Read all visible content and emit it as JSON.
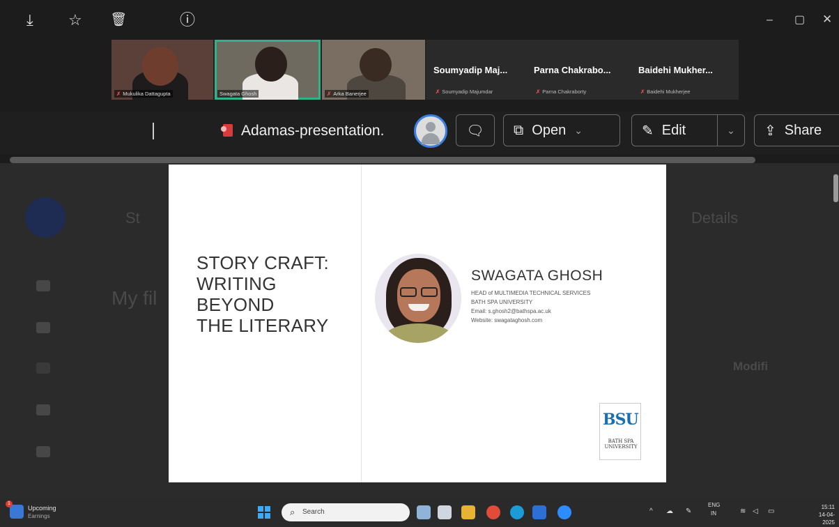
{
  "window": {
    "minimize_icon": "minimize-icon",
    "maximize_icon": "restore-icon",
    "close_icon": "close-icon",
    "minimize_glyph": "–",
    "maximize_glyph": "▢",
    "close_glyph": "✕"
  },
  "participants": [
    {
      "name": "Mukulika Dattagupta",
      "video": true,
      "active": false
    },
    {
      "name": "Swagata Ghosh",
      "video": true,
      "active": true
    },
    {
      "name": "Arka Banerjee",
      "video": true,
      "active": false
    },
    {
      "display": "Soumyadip Maj...",
      "name": "Soumyadip Majumdar",
      "video": false
    },
    {
      "display": "Parna Chakrabo...",
      "name": "Parna Chakraborty",
      "video": false
    },
    {
      "display": "Baidehi Mukher...",
      "name": "Baidehi Mukherjee",
      "video": false
    }
  ],
  "toolbar": {
    "download_glyph": "⤓",
    "star_glyph": "☆",
    "delete_glyph": "🗑",
    "info_glyph": "ⓘ",
    "filename": "Adamas-presentation.",
    "comment_glyph": "🗨",
    "open_label": "Open",
    "open_glyph": "⧉",
    "open_chevron": "⌄",
    "edit_label": "Edit",
    "edit_glyph": "✎",
    "edit_chevron": "⌄",
    "share_label": "Share",
    "share_glyph": "⇪"
  },
  "background_ui": {
    "tab1": "St",
    "tab2": "Details",
    "heading": "My fil",
    "column": "Modifi"
  },
  "slide": {
    "title_lines": [
      "STORY CRAFT:",
      "WRITING",
      "BEYOND",
      "THE LITERARY"
    ],
    "presenter_name": "SWAGATA GHOSH",
    "role": "HEAD of MULTIMEDIA TECHNICAL SERVICES",
    "org": "BATH SPA UNIVERSITY",
    "email": "Email: s.ghosh2@bathspa.ac.uk",
    "website": "Website: swagataghosh.com",
    "logo_mark": "BSU",
    "logo_sub": "BATH SPA UNIVERSITY"
  },
  "taskbar": {
    "weather_badge": "1",
    "weather_title": "Upcoming",
    "weather_sub": "Earnings",
    "search_placeholder": "Search",
    "tray_up": "^",
    "lang_top": "ENG",
    "lang_bottom": "IN",
    "time": "15:11",
    "date": "14-04-2025"
  }
}
